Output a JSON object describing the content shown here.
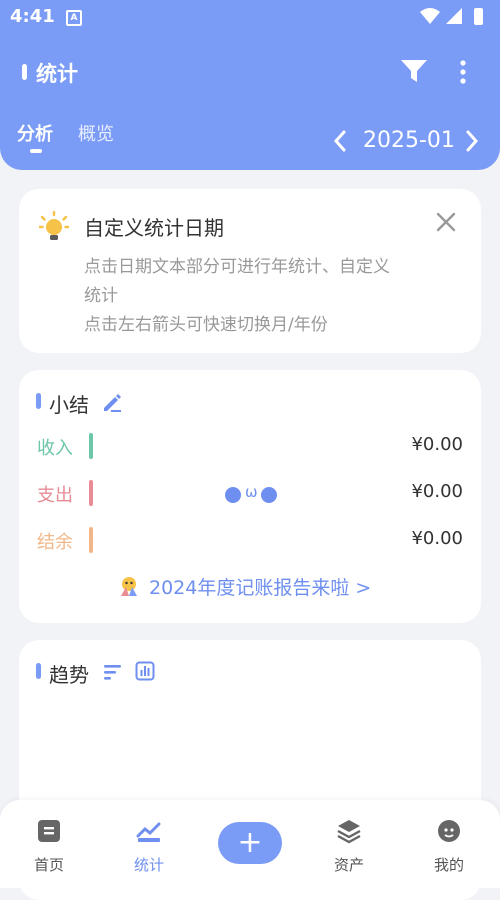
{
  "status_bar": {
    "time": "4:41",
    "notif": "A"
  },
  "app_bar": {
    "title": "统计"
  },
  "tabs": [
    {
      "label": "分析",
      "active": true
    },
    {
      "label": "概览",
      "active": false
    }
  ],
  "month": {
    "label": "2025-01"
  },
  "tip": {
    "title": "自定义统计日期",
    "line1": "点击日期文本部分可进行年统计、自定义",
    "line2": "统计",
    "line3": "点击左右箭头可快速切换月/年份"
  },
  "summary": {
    "title": "小结",
    "rows": [
      {
        "label": "收入",
        "value": "¥0.00",
        "color": "#6dc7a7"
      },
      {
        "label": "支出",
        "value": "¥0.00",
        "color": "#e88b95"
      },
      {
        "label": "结余",
        "value": "¥0.00",
        "color": "#f2b787"
      }
    ],
    "face_mouth": "ω",
    "report_link": "2024年度记账报告来啦 >"
  },
  "trend": {
    "title": "趋势"
  },
  "bottom_nav": [
    {
      "label": "首页",
      "icon": "home-icon"
    },
    {
      "label": "统计",
      "icon": "chart-icon",
      "active": true
    },
    {
      "label": "资产",
      "icon": "layers-icon"
    },
    {
      "label": "我的",
      "icon": "profile-icon"
    }
  ],
  "colors": {
    "accent": "#7b9cf6",
    "link": "#6f8ff0"
  }
}
